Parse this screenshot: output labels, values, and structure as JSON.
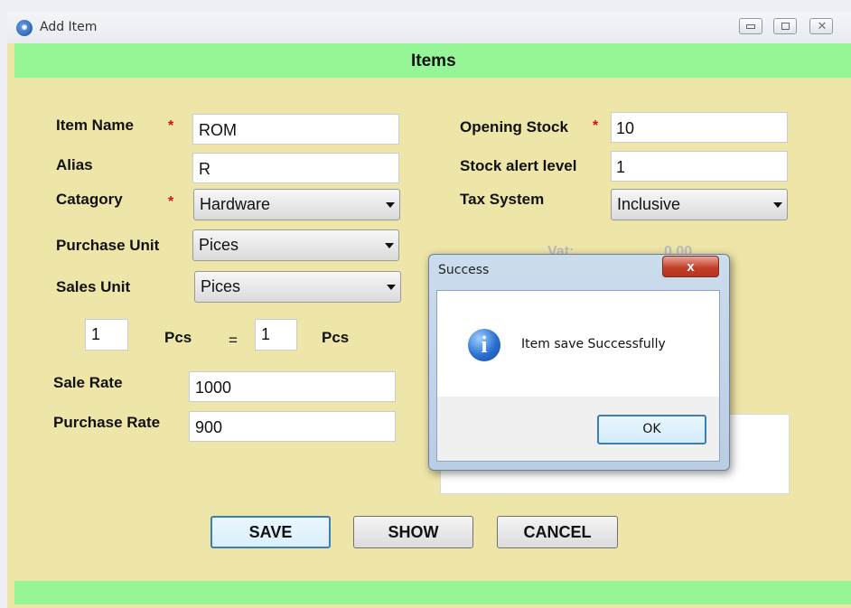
{
  "window": {
    "title": "Add Item",
    "minimize_glyph": "",
    "restore_glyph": "",
    "close_glyph": "✕"
  },
  "header": {
    "title": "Items"
  },
  "form": {
    "item_name": {
      "label": "Item Name",
      "required_mark": "*",
      "value": "ROM"
    },
    "alias": {
      "label": "Alias",
      "value": "R"
    },
    "category": {
      "label": "Catagory",
      "required_mark": "*",
      "selected": "Hardware"
    },
    "purchase_unit": {
      "label": "Purchase Unit",
      "selected": "Pices"
    },
    "sales_unit": {
      "label": "Sales Unit",
      "selected": "Pices"
    },
    "conversion": {
      "left_qty": "1",
      "left_unit": "Pcs",
      "equals": "=",
      "right_qty": "1",
      "right_unit": "Pcs"
    },
    "sale_rate": {
      "label": "Sale Rate",
      "value": "1000"
    },
    "purchase_rate": {
      "label": "Purchase Rate",
      "value": "900"
    },
    "opening_stock": {
      "label": "Opening Stock",
      "required_mark": "*",
      "value": "10"
    },
    "stock_alert": {
      "label": "Stock alert level",
      "value": "1"
    },
    "tax_system": {
      "label": "Tax System",
      "selected": "Inclusive"
    },
    "vat": {
      "label": "Vat:",
      "value": "0.00"
    }
  },
  "buttons": {
    "save": "SAVE",
    "show": "SHOW",
    "cancel": "CANCEL"
  },
  "dialog": {
    "title": "Success",
    "close_glyph": "x",
    "icon": "info-icon",
    "message": "Item save Successfully",
    "ok": "OK"
  },
  "colors": {
    "header_bg": "#96f596",
    "form_bg": "#eee6a8",
    "required": "#dd1111"
  }
}
